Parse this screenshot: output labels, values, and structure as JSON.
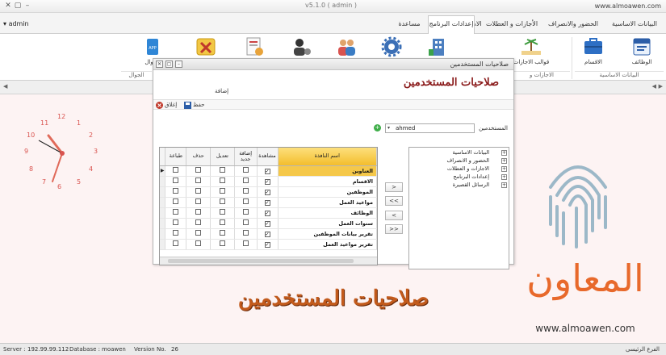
{
  "window": {
    "title": "v5.1.0 ( admin )",
    "url": "www.almoawen.com",
    "controls": [
      "–",
      "▢",
      "✕"
    ]
  },
  "user_menu": "admin",
  "tabs": [
    {
      "label": "البيانات الاساسية",
      "active": false
    },
    {
      "label": "الحضور والانصراف",
      "active": false
    },
    {
      "label": "الأجازات و العطلات",
      "active": false
    },
    {
      "label": "الاشعارات",
      "active": false
    },
    {
      "label": "إعدادات البرنامج",
      "active": true
    },
    {
      "label": "مساعدة",
      "active": false
    }
  ],
  "ribbon": {
    "buttons": [
      {
        "label": "الوظائف",
        "icon": "jobs-icon"
      },
      {
        "label": "الاقسام",
        "icon": "departments-icon"
      },
      {
        "label": "قوالب الاجازات",
        "icon": "vacation-templates-icon"
      },
      {
        "label": "",
        "icon": "building-icon"
      },
      {
        "label": "",
        "icon": "gear-icon"
      },
      {
        "label": "",
        "icon": "users-icon"
      },
      {
        "label": "",
        "icon": "user-settings-icon"
      },
      {
        "label": "",
        "icon": "report-settings-icon"
      },
      {
        "label": "",
        "icon": "tools-icon"
      },
      {
        "label": "الجوال",
        "icon": "mobile-app-icon"
      }
    ],
    "groups": [
      "البيانات الاساسية",
      "الاجازات و",
      "الجوال"
    ]
  },
  "clock": {
    "numbers": [
      "12",
      "1",
      "2",
      "3",
      "4",
      "5",
      "6",
      "7",
      "8",
      "9",
      "10",
      "11"
    ],
    "accent": "#d9534f"
  },
  "dialog": {
    "title": "صلاحيات المستخدمين",
    "heading": "صلاحيات المستخدمين",
    "add_label": "إضافة",
    "tools": {
      "close": "إغلاق",
      "save": "حفظ"
    },
    "user_label": "المستخدمين",
    "user_value": "ahmed",
    "tree": [
      "البيانات الاساسية",
      "الحضور و الانصراف",
      "الاجازات و العطلات",
      "إعدادات البرنامج",
      "الرسائل القصيرة"
    ],
    "move_buttons": [
      ">",
      "<<",
      "<",
      ">>"
    ],
    "grid": {
      "columns": {
        "name": "اسم النافذة",
        "view": "مشاهدة",
        "add_new": "إضافة جديد",
        "edit": "تعديل",
        "delete": "حذف",
        "print": "طباعة"
      },
      "rows": [
        {
          "name": "العناوين",
          "view": true,
          "add": false,
          "edit": false,
          "del": false,
          "print": false,
          "selected": true
        },
        {
          "name": "الاقسام",
          "view": true,
          "add": false,
          "edit": false,
          "del": false,
          "print": false,
          "selected": false
        },
        {
          "name": "الموظفين",
          "view": true,
          "add": false,
          "edit": false,
          "del": false,
          "print": false,
          "selected": false
        },
        {
          "name": "مواعيد العمل",
          "view": true,
          "add": false,
          "edit": false,
          "del": false,
          "print": false,
          "selected": false
        },
        {
          "name": "الوظائف",
          "view": true,
          "add": false,
          "edit": false,
          "del": false,
          "print": false,
          "selected": false
        },
        {
          "name": "سنوات العمل",
          "view": true,
          "add": false,
          "edit": false,
          "del": false,
          "print": false,
          "selected": false
        },
        {
          "name": "تقرير بيانات الموظفين",
          "view": true,
          "add": false,
          "edit": false,
          "del": false,
          "print": false,
          "selected": false
        },
        {
          "name": "تقرير مواعيد العمل",
          "view": true,
          "add": false,
          "edit": false,
          "del": false,
          "print": false,
          "selected": false
        }
      ]
    }
  },
  "caption": "صلاحيات المستخدمين",
  "brand": {
    "name": "المعاون",
    "site": "www.almoawen.com",
    "color": "#e8692b"
  },
  "status": {
    "server_label": "Server :",
    "server": "192.99.99.112",
    "db_label": "Database :",
    "db": "moawen",
    "ver_label": "Version No.",
    "ver": "26",
    "branch": "الفرع الرئيسى"
  }
}
